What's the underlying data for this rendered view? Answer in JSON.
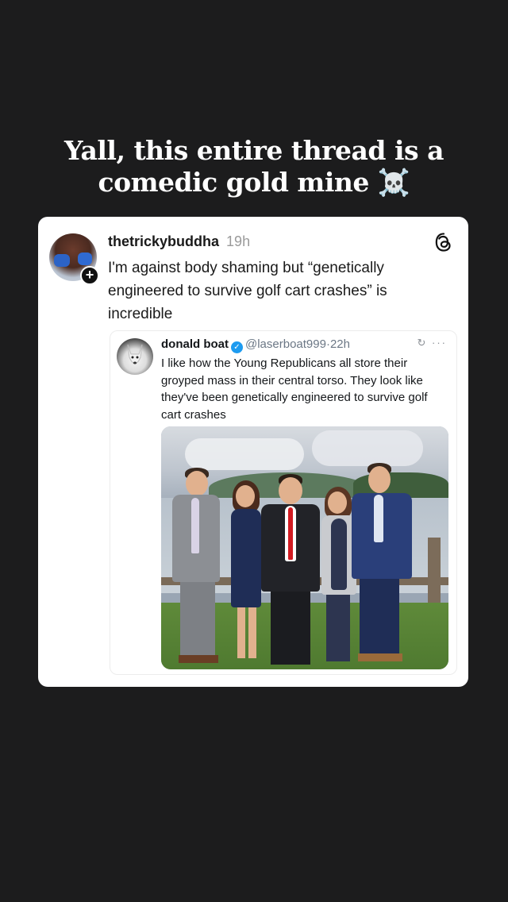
{
  "caption": {
    "line1": "Yall, this entire thread is a",
    "line2": "comedic gold mine ☠️"
  },
  "post": {
    "username": "thetrickybuddha",
    "time": "19h",
    "text": "I'm against body shaming but “genetically engineered to survive golf cart crashes” is incredible",
    "follow_symbol": "+"
  },
  "embed": {
    "name": "donald boat",
    "handle": "@laserboat999",
    "separator": "·",
    "time": "22h",
    "icons": "↻ ···",
    "text": "I like how the Young Republicans all store their groyped mass in their central torso. They look like they've been genetically engineered to survive golf cart crashes"
  },
  "colors": {
    "background": "#1c1c1d",
    "card": "#ffffff",
    "verified": "#1d9bf0"
  }
}
